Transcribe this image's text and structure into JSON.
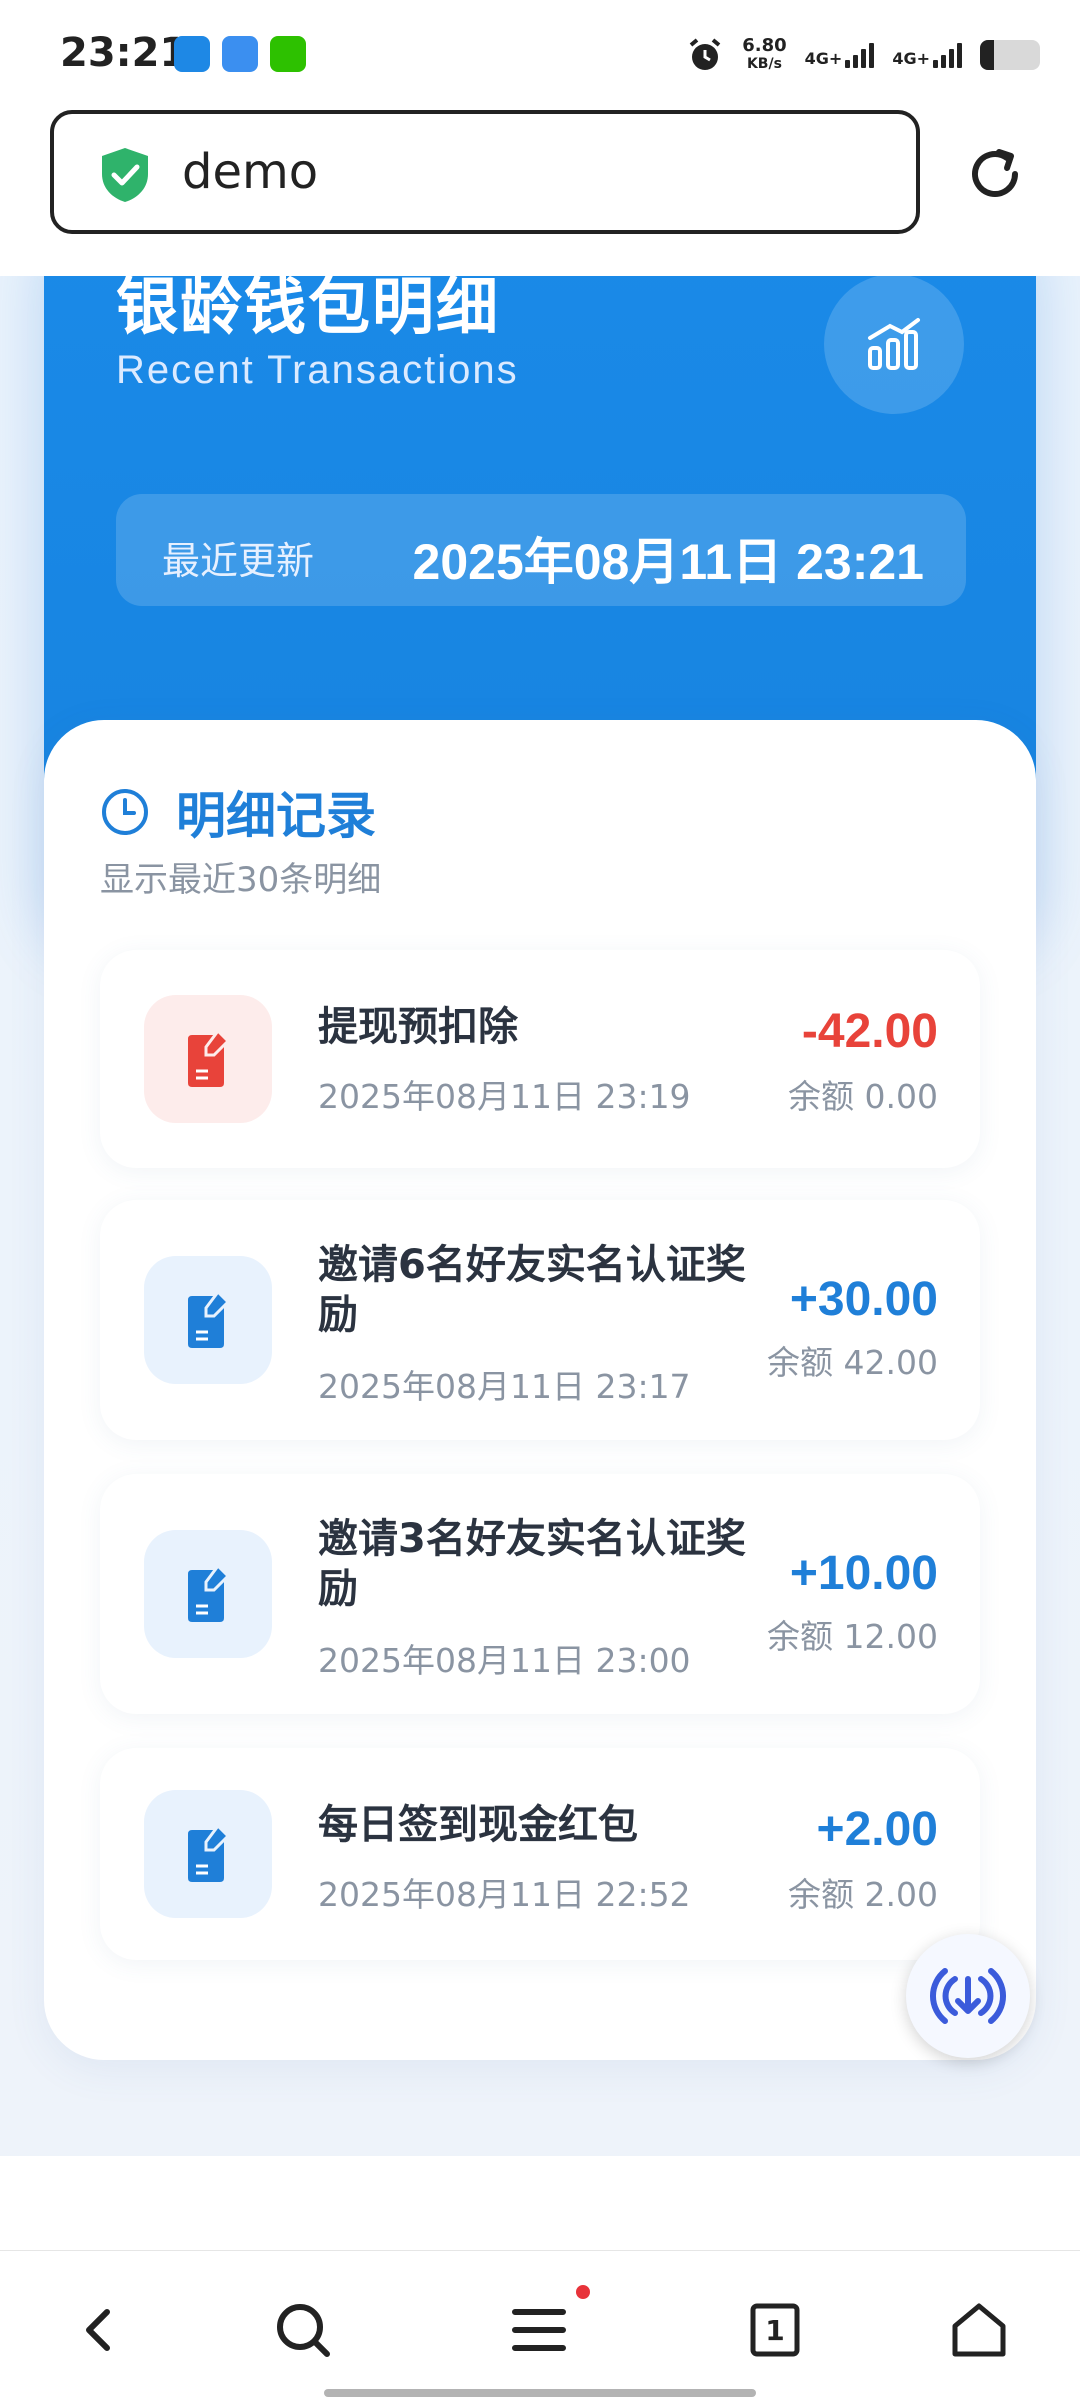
{
  "status_bar": {
    "time": "23:21",
    "net_speed_value": "6.80",
    "net_speed_unit": "KB/s",
    "network_1": "4G+",
    "network_2": "4G+"
  },
  "browser": {
    "url": "demo"
  },
  "hero": {
    "title": "银龄钱包明细",
    "subtitle": "Recent Transactions",
    "update_label": "最近更新",
    "update_value": "2025年08月11日 23:21"
  },
  "records": {
    "title": "明细记录",
    "subtitle": "显示最近30条明细",
    "items": [
      {
        "title": "提现预扣除",
        "date": "2025年08月11日 23:19",
        "amount": "-42.00",
        "balance": "余额 0.00",
        "type": "debit"
      },
      {
        "title": "邀请6名好友实名认证奖励",
        "date": "2025年08月11日 23:17",
        "amount": "+30.00",
        "balance": "余额 42.00",
        "type": "credit"
      },
      {
        "title": "邀请3名好友实名认证奖励",
        "date": "2025年08月11日 23:00",
        "amount": "+10.00",
        "balance": "余额 12.00",
        "type": "credit"
      },
      {
        "title": "每日签到现金红包",
        "date": "2025年08月11日 22:52",
        "amount": "+2.00",
        "balance": "余额 2.00",
        "type": "credit"
      }
    ]
  },
  "colors": {
    "primary": "#1783df",
    "debit": "#e8433a",
    "credit": "#1f7fd8"
  },
  "nav": {
    "tabs_count": "1"
  }
}
